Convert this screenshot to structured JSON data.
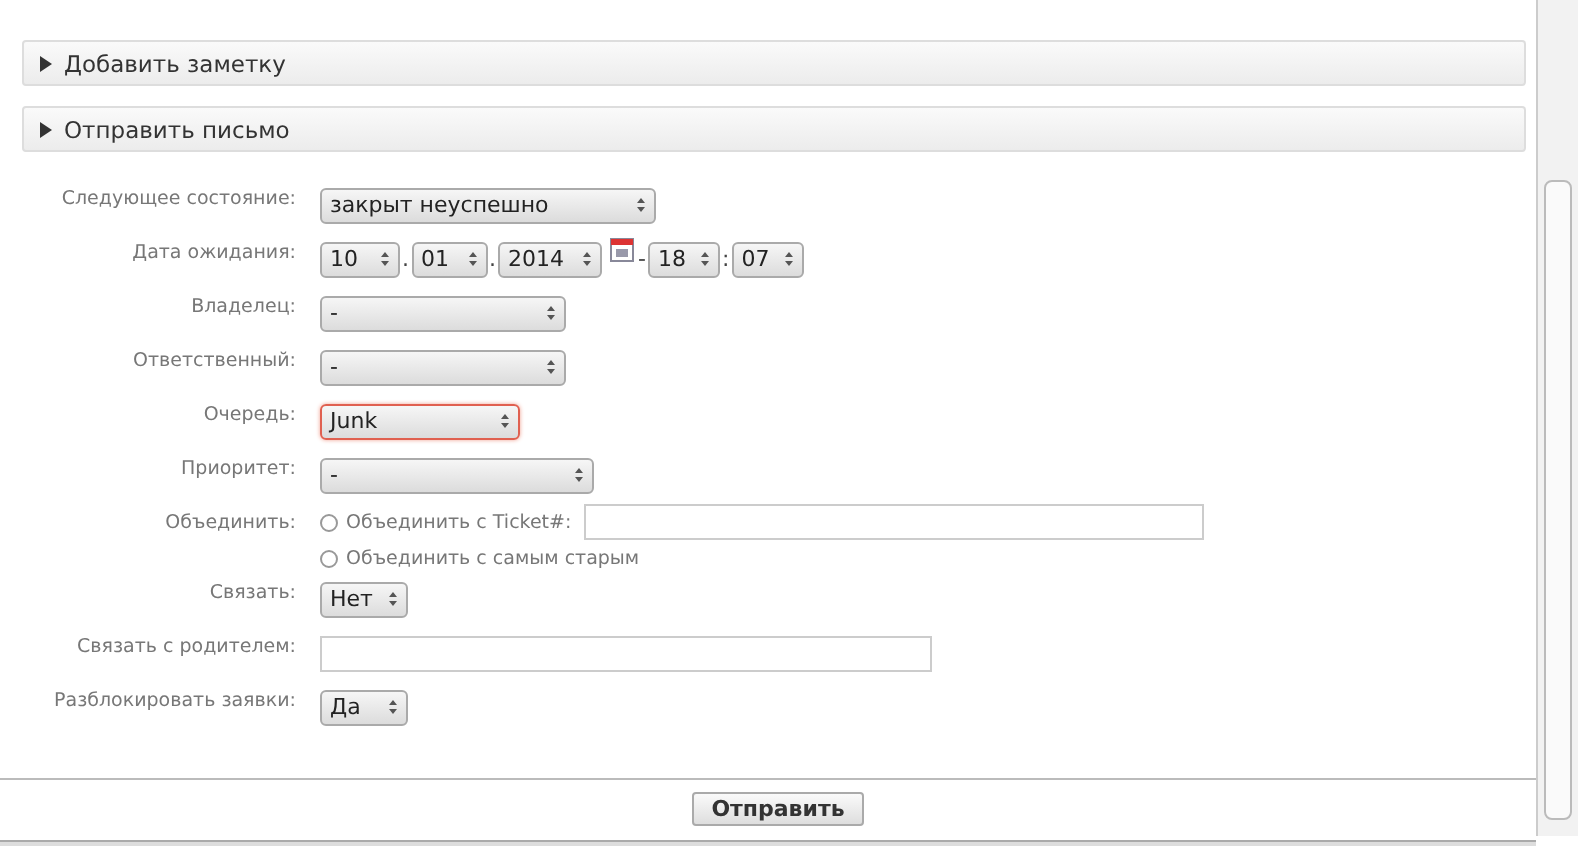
{
  "sections": [
    {
      "title": "Добавить заметку",
      "expanded": false
    },
    {
      "title": "Отправить письмо",
      "expanded": false
    }
  ],
  "form": [
    {
      "kind": "select",
      "label": "Следующее состояние:",
      "value": "закрыт неуспешно",
      "error": false
    },
    {
      "kind": "date",
      "label": "Дата ожидания:",
      "parts": [
        {
          "kind": "select",
          "value": "10"
        },
        {
          "kind": "sep",
          "text": "."
        },
        {
          "kind": "select",
          "value": "01"
        },
        {
          "kind": "sep",
          "text": "."
        },
        {
          "kind": "select",
          "value": "2014"
        },
        {
          "kind": "calendar"
        },
        {
          "kind": "sep",
          "text": "-"
        },
        {
          "kind": "select",
          "value": "18"
        },
        {
          "kind": "sep",
          "text": ":"
        },
        {
          "kind": "select",
          "value": "07"
        }
      ]
    },
    {
      "kind": "select",
      "label": "Владелец:",
      "value": "-",
      "error": false
    },
    {
      "kind": "select",
      "label": "Ответственный:",
      "value": "-",
      "error": false
    },
    {
      "kind": "select",
      "label": "Очередь:",
      "value": "Junk",
      "error": true
    },
    {
      "kind": "select",
      "label": "Приоритет:",
      "value": "-",
      "error": false
    },
    {
      "kind": "radios",
      "label": "Объединить:",
      "options": [
        {
          "kind": "with-field",
          "label": "Объединить с Ticket#:",
          "selected": false
        },
        {
          "kind": "plain",
          "label": "Объединить с самым старым",
          "selected": false
        }
      ]
    },
    {
      "kind": "select",
      "label": "Связать:",
      "value": "Нет",
      "error": false
    },
    {
      "kind": "text",
      "label": "Связать с родителем:"
    },
    {
      "kind": "select",
      "label": "Разблокировать заявки:",
      "value": "Да",
      "error": false
    }
  ],
  "submit": "Отправить"
}
